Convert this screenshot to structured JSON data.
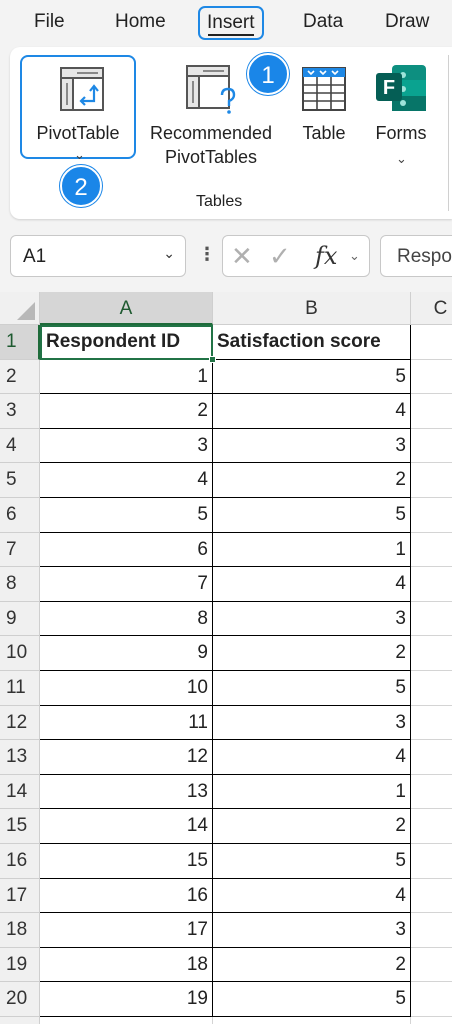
{
  "menu": {
    "items": [
      {
        "label": "File"
      },
      {
        "label": "Home"
      },
      {
        "label": "Insert"
      },
      {
        "label": "Data"
      },
      {
        "label": "Draw"
      }
    ],
    "active": "Insert"
  },
  "ribbon": {
    "pivot_table_label": "PivotTable",
    "recommended_line1": "Recommended",
    "recommended_line2": "PivotTables",
    "table_label": "Table",
    "forms_label": "Forms",
    "group_label": "Tables"
  },
  "badges": {
    "step1": "1",
    "step2": "2"
  },
  "formula_bar": {
    "name_box": "A1",
    "fx_symbol": "fx",
    "formula_value": "Respondent ID"
  },
  "grid": {
    "columns": [
      "A",
      "B",
      "C"
    ],
    "row_numbers": [
      "1",
      "2",
      "3",
      "4",
      "5",
      "6",
      "7",
      "8",
      "9",
      "10",
      "11",
      "12",
      "13",
      "14",
      "15",
      "16",
      "17",
      "18",
      "19",
      "20"
    ],
    "header": [
      "Respondent ID",
      "Satisfaction score"
    ],
    "rows": [
      [
        "1",
        "5"
      ],
      [
        "2",
        "4"
      ],
      [
        "3",
        "3"
      ],
      [
        "4",
        "2"
      ],
      [
        "5",
        "5"
      ],
      [
        "6",
        "1"
      ],
      [
        "7",
        "4"
      ],
      [
        "8",
        "3"
      ],
      [
        "9",
        "2"
      ],
      [
        "10",
        "5"
      ],
      [
        "11",
        "3"
      ],
      [
        "12",
        "4"
      ],
      [
        "13",
        "1"
      ],
      [
        "14",
        "2"
      ],
      [
        "15",
        "5"
      ],
      [
        "16",
        "4"
      ],
      [
        "17",
        "3"
      ],
      [
        "18",
        "2"
      ],
      [
        "19",
        "5"
      ]
    ]
  },
  "colors": {
    "accent": "#1e88e5",
    "selection_green": "#217346",
    "forms_green": "#077568"
  }
}
